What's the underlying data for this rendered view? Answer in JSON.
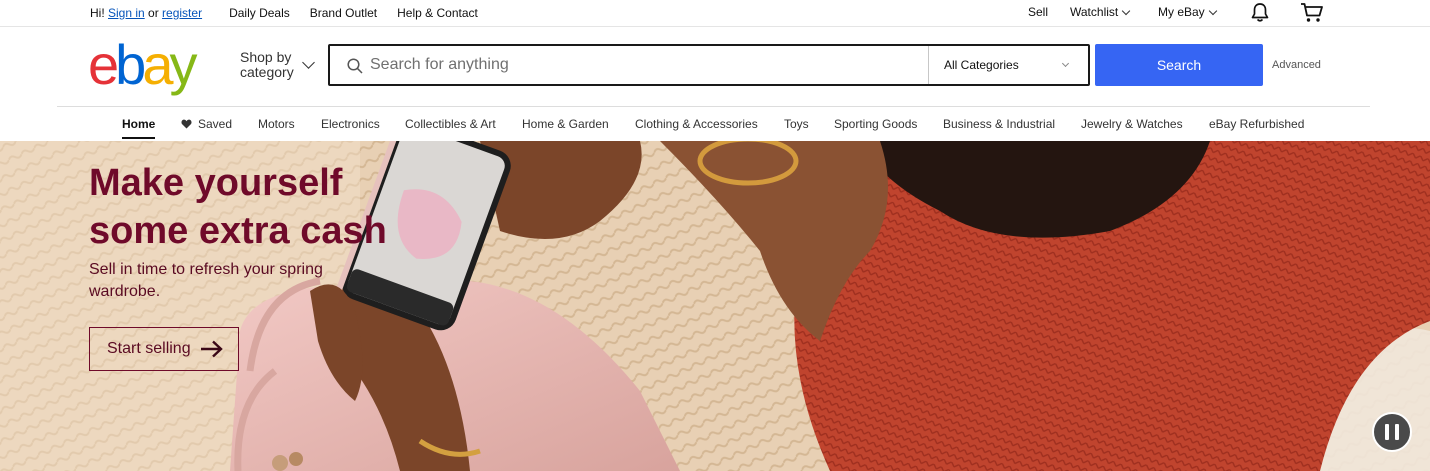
{
  "topbar": {
    "greeting_prefix": "Hi! ",
    "sign_in": "Sign in",
    "or_text": " or ",
    "register": "register",
    "links": [
      "Daily Deals",
      "Brand Outlet",
      "Help & Contact"
    ],
    "sell": "Sell",
    "watchlist": "Watchlist",
    "my_ebay": "My eBay"
  },
  "header": {
    "logo_letters": [
      "e",
      "b",
      "a",
      "y"
    ],
    "logo_colors": [
      "#e53238",
      "#0064d2",
      "#f5af02",
      "#86b817"
    ],
    "shop_by_line1": "Shop by",
    "shop_by_line2": "category",
    "search_placeholder": "Search for anything",
    "category_selected": "All Categories",
    "search_button": "Search",
    "advanced": "Advanced"
  },
  "nav": {
    "items": [
      "Home",
      "Saved",
      "Motors",
      "Electronics",
      "Collectibles & Art",
      "Home & Garden",
      "Clothing & Accessories",
      "Toys",
      "Sporting Goods",
      "Business & Industrial",
      "Jewelry & Watches",
      "eBay Refurbished"
    ],
    "active": "Home"
  },
  "hero": {
    "title": "Make yourself some extra cash",
    "subtitle": "Sell in time to refresh your spring wardrobe.",
    "cta": "Start selling"
  },
  "colors": {
    "brand_blue": "#3665f3",
    "hero_text": "#6f0a2a"
  }
}
